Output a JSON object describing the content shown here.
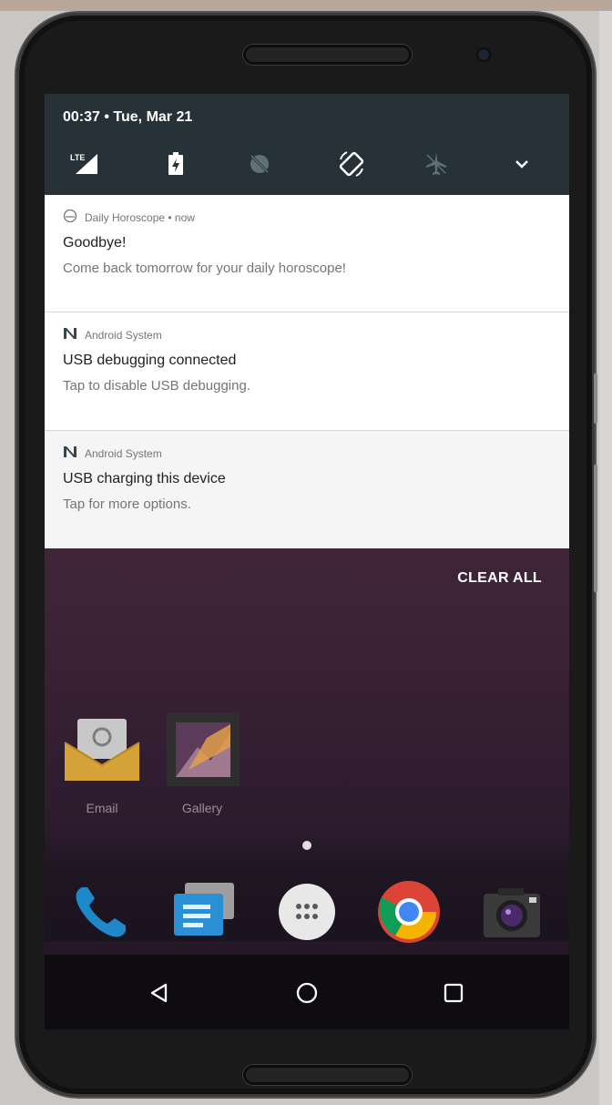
{
  "status_bar": {
    "time_date": "00:37 • Tue, Mar 21",
    "network_label": "LTE"
  },
  "quick_settings": [
    {
      "name": "lte-signal-icon"
    },
    {
      "name": "battery-icon"
    },
    {
      "name": "do-not-disturb-icon"
    },
    {
      "name": "auto-rotate-icon"
    },
    {
      "name": "airplane-mode-icon"
    },
    {
      "name": "expand-chevron-icon"
    }
  ],
  "notifications": [
    {
      "app": "Daily Horoscope • now",
      "title": "Goodbye!",
      "text": "Come back tomorrow for your daily horoscope!"
    },
    {
      "app": "Android System",
      "title": "USB debugging connected",
      "text": "Tap to disable USB debugging."
    },
    {
      "app": "Android System",
      "title": "USB charging this device",
      "text": "Tap for more options."
    }
  ],
  "clear_all_label": "CLEAR ALL",
  "home_apps": [
    {
      "label": "Email"
    },
    {
      "label": "Gallery"
    }
  ],
  "dock": [
    {
      "name": "phone-app"
    },
    {
      "name": "messages-app"
    },
    {
      "name": "app-drawer"
    },
    {
      "name": "chrome-app"
    },
    {
      "name": "camera-app"
    }
  ],
  "navigation": {
    "back": "back-icon",
    "home": "home-icon",
    "recents": "recents-icon"
  },
  "colors": {
    "header_bg": "#263238",
    "notification_bg": "#ffffff",
    "wallpaper": "#4a2a3f"
  }
}
